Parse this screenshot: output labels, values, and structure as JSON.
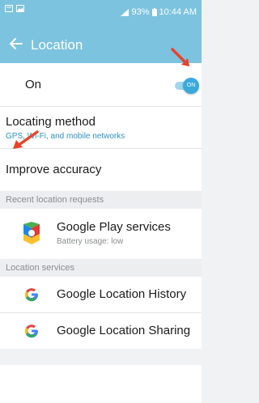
{
  "status_bar": {
    "battery_percent": "93%",
    "time": "10:44 AM",
    "icons": [
      "message-icon",
      "image-icon",
      "signal-icon",
      "battery-icon"
    ]
  },
  "app_bar": {
    "title": "Location",
    "back_icon": "arrow-left-icon"
  },
  "master_toggle": {
    "label": "On",
    "state_text": "ON",
    "enabled": true,
    "accent": "#3aa9dc"
  },
  "locating_method": {
    "label": "Locating method",
    "value": "GPS, Wi-Fi, and mobile networks"
  },
  "improve_accuracy": {
    "label": "Improve accuracy"
  },
  "recent_requests": {
    "header": "Recent location requests",
    "items": [
      {
        "name": "Google Play services",
        "detail": "Battery usage: low",
        "icon": "google-play-services-icon"
      }
    ]
  },
  "location_services": {
    "header": "Location services",
    "items": [
      {
        "name": "Google Location History",
        "icon": "google-g-icon"
      },
      {
        "name": "Google Location Sharing",
        "icon": "google-g-icon"
      }
    ]
  },
  "colors": {
    "header_bg": "#7cc3df",
    "link_blue": "#2c91c5",
    "annotation_red": "#e8432b"
  }
}
